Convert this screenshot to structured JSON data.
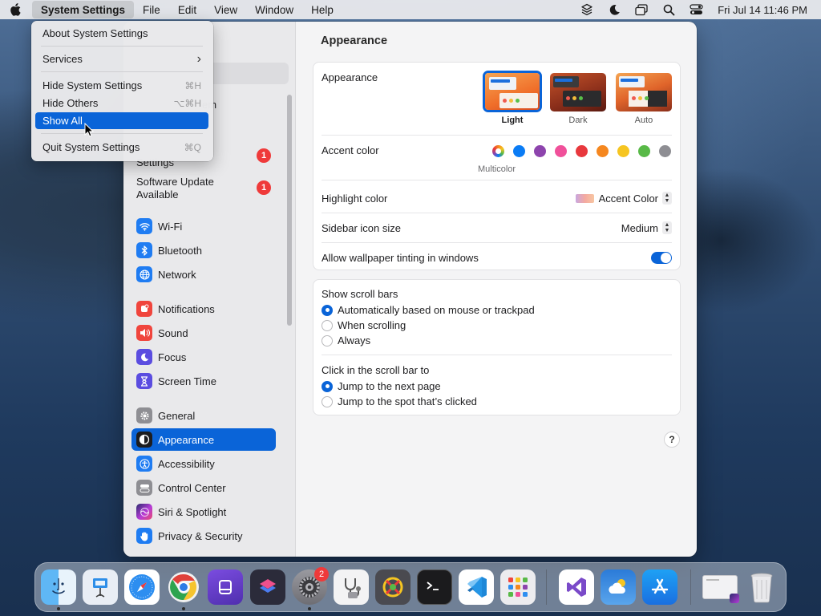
{
  "menubar": {
    "app_name": "System Settings",
    "menus": [
      "File",
      "Edit",
      "View",
      "Window",
      "Help"
    ],
    "clock": "Fri Jul 14  11:46 PM",
    "status_icons": [
      "layers-icon",
      "moon-icon",
      "windows-icon",
      "search-icon",
      "control-center-icon"
    ]
  },
  "app_menu": {
    "items": [
      {
        "label": "About System Settings",
        "shortcut": ""
      },
      {
        "label": "Services",
        "shortcut": "›"
      },
      {
        "label": "Hide System Settings",
        "shortcut": "⌘H"
      },
      {
        "label": "Hide Others",
        "shortcut": "⌥⌘H"
      },
      {
        "label": "Show All",
        "shortcut": ""
      },
      {
        "label": "Quit System Settings",
        "shortcut": "⌘Q"
      }
    ],
    "highlighted": "Show All"
  },
  "sidebar": {
    "partial_label": "em",
    "update_rows": [
      {
        "label": "Settings",
        "badge": "1"
      },
      {
        "label": "Software Update\nAvailable",
        "badge": "1"
      }
    ],
    "items": [
      {
        "label": "Wi-Fi",
        "icon": "wifi-icon",
        "color": "#1f7cf2"
      },
      {
        "label": "Bluetooth",
        "icon": "bluetooth-icon",
        "color": "#1f7cf2"
      },
      {
        "label": "Network",
        "icon": "globe-icon",
        "color": "#1f7cf2"
      },
      {
        "label": "Notifications",
        "icon": "bell-icon",
        "color": "#f0453d"
      },
      {
        "label": "Sound",
        "icon": "speaker-icon",
        "color": "#f0453d"
      },
      {
        "label": "Focus",
        "icon": "moon-icon",
        "color": "#5b4de0"
      },
      {
        "label": "Screen Time",
        "icon": "hourglass-icon",
        "color": "#5b4de0"
      },
      {
        "label": "General",
        "icon": "gear-icon",
        "color": "#8e8e93"
      },
      {
        "label": "Appearance",
        "icon": "appearance-icon",
        "color": "#1d1d1f"
      },
      {
        "label": "Accessibility",
        "icon": "accessibility-icon",
        "color": "#1f7cf2"
      },
      {
        "label": "Control Center",
        "icon": "control-center-icon",
        "color": "#8e8e93"
      },
      {
        "label": "Siri & Spotlight",
        "icon": "siri-icon",
        "color": "#c33bd6"
      },
      {
        "label": "Privacy & Security",
        "icon": "hand-icon",
        "color": "#1f7cf2"
      }
    ],
    "selected": "Appearance"
  },
  "main": {
    "title": "Appearance",
    "appearance": {
      "label": "Appearance",
      "options": [
        "Light",
        "Dark",
        "Auto"
      ],
      "selected": "Light"
    },
    "accent": {
      "label": "Accent color",
      "caption": "Multicolor",
      "colors": [
        "#ffffff",
        "#0a7cf5",
        "#8d44ad",
        "#f0509a",
        "#e8383d",
        "#f5871f",
        "#f6c521",
        "#58b947",
        "#8e8e93"
      ]
    },
    "highlight": {
      "label": "Highlight color",
      "value": "Accent Color"
    },
    "icon_size": {
      "label": "Sidebar icon size",
      "value": "Medium"
    },
    "tinting": {
      "label": "Allow wallpaper tinting in windows",
      "on": true
    },
    "scroll_bars": {
      "label": "Show scroll bars",
      "options": [
        "Automatically based on mouse or trackpad",
        "When scrolling",
        "Always"
      ],
      "selected": "Automatically based on mouse or trackpad"
    },
    "click_scroll": {
      "label": "Click in the scroll bar to",
      "options": [
        "Jump to the next page",
        "Jump to the spot that’s clicked"
      ],
      "selected": "Jump to the next page"
    },
    "help": "?"
  },
  "dock": {
    "apps": [
      "finder-icon",
      "keynote-icon",
      "safari-icon",
      "chrome-icon",
      "podcast-app-icon",
      "shortcuts-icon",
      "system-settings-icon",
      "stethoscope-icon",
      "colors-icon",
      "terminal-icon",
      "vscode-icon",
      "launchpad-icon",
      "visual-studio-icon",
      "weather-icon",
      "app-store-icon",
      "window-preview-icon",
      "trash-icon"
    ],
    "settings_badge": "2"
  }
}
